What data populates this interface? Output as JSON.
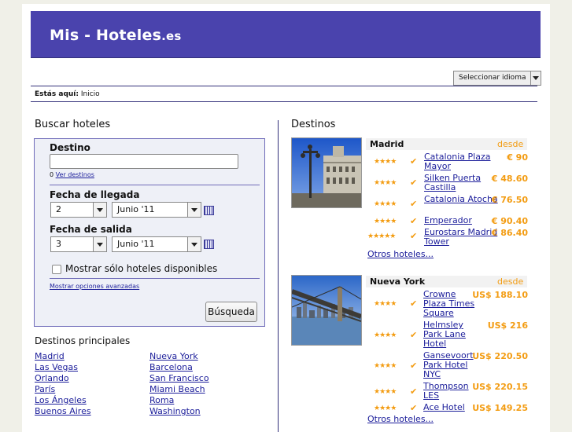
{
  "logo": {
    "main": "Mis - Hoteles",
    "tld": ".es"
  },
  "language_button": "Seleccionar idioma",
  "breadcrumb": {
    "label": "Estás aquí:",
    "current": "Inicio"
  },
  "search": {
    "title": "Buscar hoteles",
    "destino_label": "Destino",
    "destino_value": "",
    "count": "0",
    "ver_destinos": "Ver destinos",
    "arrival_label": "Fecha de llegada",
    "arrival_day": "2",
    "arrival_month": "Junio '11",
    "departure_label": "Fecha de salida",
    "departure_day": "3",
    "departure_month": "Junio '11",
    "only_available": "Mostrar sólo hoteles disponibles",
    "advanced": "Mostrar opciones avanzadas",
    "button": "Búsqueda"
  },
  "principales": {
    "title": "Destinos principales",
    "col1": [
      "Madrid",
      "Las Vegas",
      "Orlando",
      "París",
      "Los Ángeles",
      "Buenos Aires"
    ],
    "col2": [
      "Nueva York",
      "Barcelona",
      "San Francisco",
      "Miami Beach",
      "Roma",
      "Washington"
    ]
  },
  "destinos": {
    "title": "Destinos",
    "cities": [
      {
        "name": "Madrid",
        "desde": "desde",
        "otros": "Otros hoteles...",
        "hotels": [
          {
            "stars": "★★★★",
            "name": "Catalonia Plaza Mayor",
            "price": "€ 90"
          },
          {
            "stars": "★★★★",
            "name": "Silken Puerta Castilla",
            "price": "€ 48.60"
          },
          {
            "stars": "★★★★",
            "name": "Catalonia Atocha",
            "price": "€ 76.50"
          },
          {
            "stars": "★★★★",
            "name": "Emperador",
            "price": "€ 90.40"
          },
          {
            "stars": "★★★★★",
            "name": "Eurostars Madrid Tower",
            "price": "€ 86.40"
          }
        ]
      },
      {
        "name": "Nueva York",
        "desde": "desde",
        "otros": "Otros hoteles...",
        "hotels": [
          {
            "stars": "★★★★",
            "name": "Crowne Plaza Times Square",
            "price": "US$ 188.10"
          },
          {
            "stars": "★★★★",
            "name": "Helmsley Park Lane Hotel",
            "price": "US$ 216"
          },
          {
            "stars": "★★★★",
            "name": "Gansevoort Park Hotel NYC",
            "price": "US$ 220.50"
          },
          {
            "stars": "★★★★",
            "name": "Thompson LES",
            "price": "US$ 220.15"
          },
          {
            "stars": "★★★★",
            "name": "Ace Hotel",
            "price": "US$ 149.25"
          }
        ]
      }
    ]
  },
  "colors": {
    "banner": "#4a43ad",
    "accent": "#f39c12",
    "link": "#1b1d9a"
  }
}
